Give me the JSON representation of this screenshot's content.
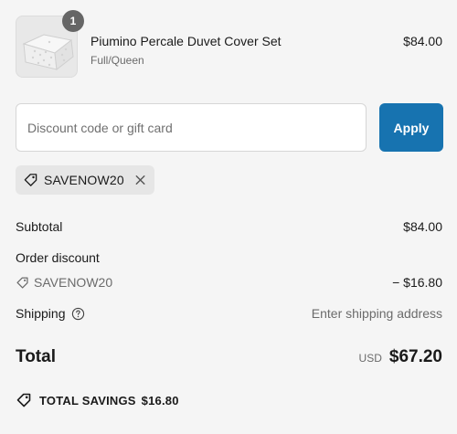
{
  "product": {
    "quantity": "1",
    "name": "Piumino Percale Duvet Cover Set",
    "variant": "Full/Queen",
    "price": "$84.00",
    "image_icon": "duvet-thumbnail"
  },
  "discount_form": {
    "placeholder": "Discount code or gift card",
    "value": "",
    "apply_label": "Apply",
    "accent_color": "#1773b0"
  },
  "applied_code": {
    "code": "SAVENOW20",
    "tag_icon": "tag-icon",
    "remove_icon": "close-icon"
  },
  "summary": {
    "subtotal_label": "Subtotal",
    "subtotal_value": "$84.00",
    "order_discount_label": "Order discount",
    "discount_code": "SAVENOW20",
    "discount_value": "− $16.80",
    "shipping_label": "Shipping",
    "shipping_value": "Enter shipping address",
    "help_icon": "help-circle-icon",
    "total_label": "Total",
    "total_currency": "USD",
    "total_value": "$67.20",
    "savings_label": "TOTAL SAVINGS",
    "savings_value": "$16.80"
  }
}
